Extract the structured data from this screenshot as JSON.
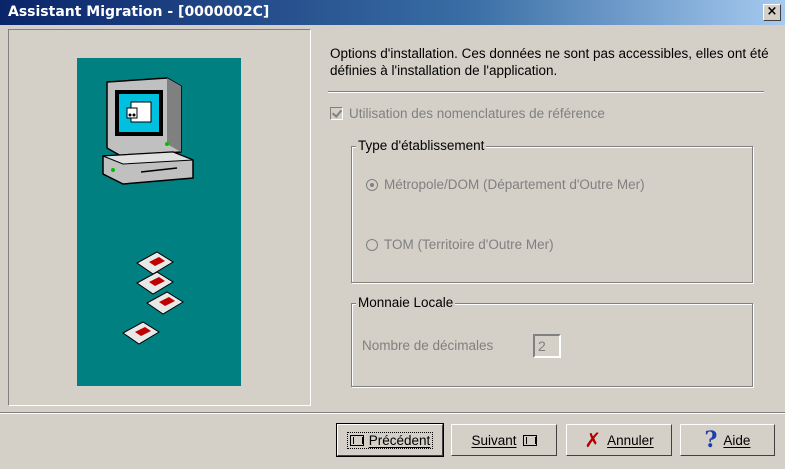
{
  "window": {
    "title": "Assistant Migration - [0000002C]",
    "close_label": "×"
  },
  "description": "Options d'installation. Ces données ne sont pas accessibles, elles ont été définies à l'installation de l'application.",
  "nomenclature": {
    "label": "Utilisation des nomenclatures de référence",
    "checked": true,
    "enabled": false
  },
  "type_etablissement": {
    "legend": "Type d'établissement",
    "options": [
      {
        "label": "Métropole/DOM (Département d'Outre Mer)",
        "selected": true
      },
      {
        "label": "TOM (Territoire d'Outre Mer)",
        "selected": false
      }
    ]
  },
  "monnaie": {
    "legend": "Monnaie Locale",
    "decimals_label": "Nombre de décimales",
    "decimals_value": "2"
  },
  "buttons": {
    "previous": "Précédent",
    "next": "Suivant",
    "cancel": "Annuler",
    "help": "Aide"
  },
  "colors": {
    "title_start": "#0a246a",
    "title_end": "#a6caf0",
    "panel_teal": "#008080",
    "disabled_text": "#808080",
    "cancel_icon": "#b00000",
    "help_icon": "#1a3fb0"
  },
  "icons": [
    "computer-icon",
    "floppy-disk-icon",
    "close-icon",
    "previous-icon",
    "next-icon",
    "cancel-x-icon",
    "help-question-icon"
  ]
}
